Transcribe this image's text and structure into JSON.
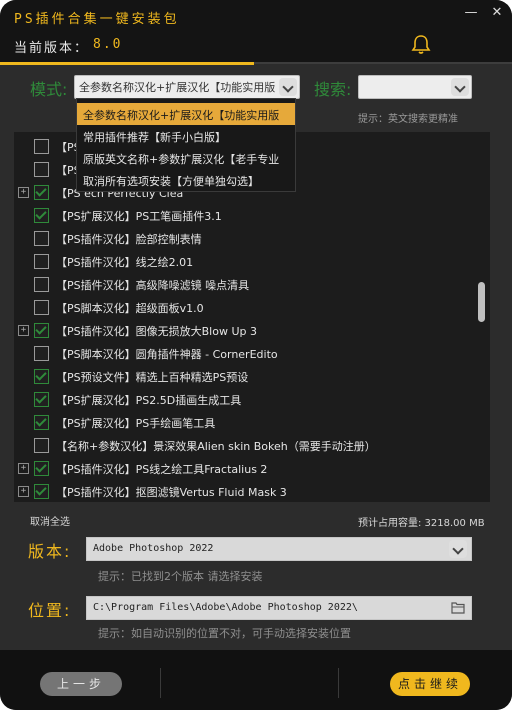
{
  "window": {
    "title": "PS插件合集一键安装包",
    "version_label": "当前版本：",
    "version_value": "8.0",
    "minimize_glyph": "—",
    "close_glyph": "✕",
    "bell_icon": "bell-icon",
    "accent_color": "#f0b81e"
  },
  "mode": {
    "label": "模式:",
    "value": "全参数名称汉化+扩展汉化【功能实用版",
    "options": [
      "全参数名称汉化+扩展汉化【功能实用版",
      "常用插件推荐【新手小白版】",
      "原版英文名称+参数扩展汉化【老手专业",
      "取消所有选项安装【方便单独勾选】"
    ]
  },
  "search": {
    "label": "搜索:",
    "value": "",
    "hint": "提示：英文搜索更精准"
  },
  "list": {
    "items": [
      {
        "text": "【PS",
        "checked": false,
        "expander": false
      },
      {
        "text": "【PS                                   Flood",
        "checked": false,
        "expander": false
      },
      {
        "text": "【PS                                   ech Perfectly Clea",
        "checked": true,
        "expander": true
      },
      {
        "text": "【PS扩展汉化】PS工笔画插件3.1",
        "checked": true,
        "expander": false
      },
      {
        "text": "【PS插件汉化】脸部控制表情",
        "checked": false,
        "expander": false
      },
      {
        "text": "【PS插件汉化】线之绘2.01",
        "checked": false,
        "expander": false
      },
      {
        "text": "【PS插件汉化】高级降噪滤镜 噪点清具",
        "checked": false,
        "expander": false
      },
      {
        "text": "【PS脚本汉化】超级面板v1.0",
        "checked": false,
        "expander": false
      },
      {
        "text": "【PS插件汉化】图像无损放大Blow Up 3",
        "checked": true,
        "expander": true
      },
      {
        "text": "【PS脚本汉化】圆角插件神器 - CornerEdito",
        "checked": false,
        "expander": false
      },
      {
        "text": "【PS预设文件】精选上百种精选PS预设",
        "checked": true,
        "expander": false
      },
      {
        "text": "【PS扩展汉化】PS2.5D插画生成工具",
        "checked": true,
        "expander": false
      },
      {
        "text": "【PS扩展汉化】PS手绘画笔工具",
        "checked": true,
        "expander": false
      },
      {
        "text": "【名称+参数汉化】景深效果Alien skin Bokeh（需要手动注册）",
        "checked": false,
        "expander": false
      },
      {
        "text": "【PS插件汉化】PS线之绘工具Fractalius 2",
        "checked": true,
        "expander": true
      },
      {
        "text": "【PS插件汉化】抠图滤镜Vertus Fluid Mask 3",
        "checked": true,
        "expander": true
      }
    ],
    "expander_glyph": "+"
  },
  "selection": {
    "deselect_all": "取消全选",
    "estimated_space": "预计占用容量: 3218.00 MB"
  },
  "version_select": {
    "label": "版本:",
    "value": "Adobe Photoshop 2022",
    "hint": "提示：已找到2个版本 请选择安装"
  },
  "location": {
    "label": "位置:",
    "value": "C:\\Program Files\\Adobe\\Adobe Photoshop 2022\\",
    "hint": "提示：如自动识别的位置不对，可手动选择安装位置",
    "browse_icon": "folder-icon"
  },
  "footer": {
    "back_label": "上一步",
    "next_label": "点击继续"
  },
  "colors": {
    "window_bg": "#2c2c2c",
    "header_bg": "#141414",
    "green_label": "#2f8a3a",
    "menu_selected": "#e6a93a",
    "back_button": "#757575"
  }
}
